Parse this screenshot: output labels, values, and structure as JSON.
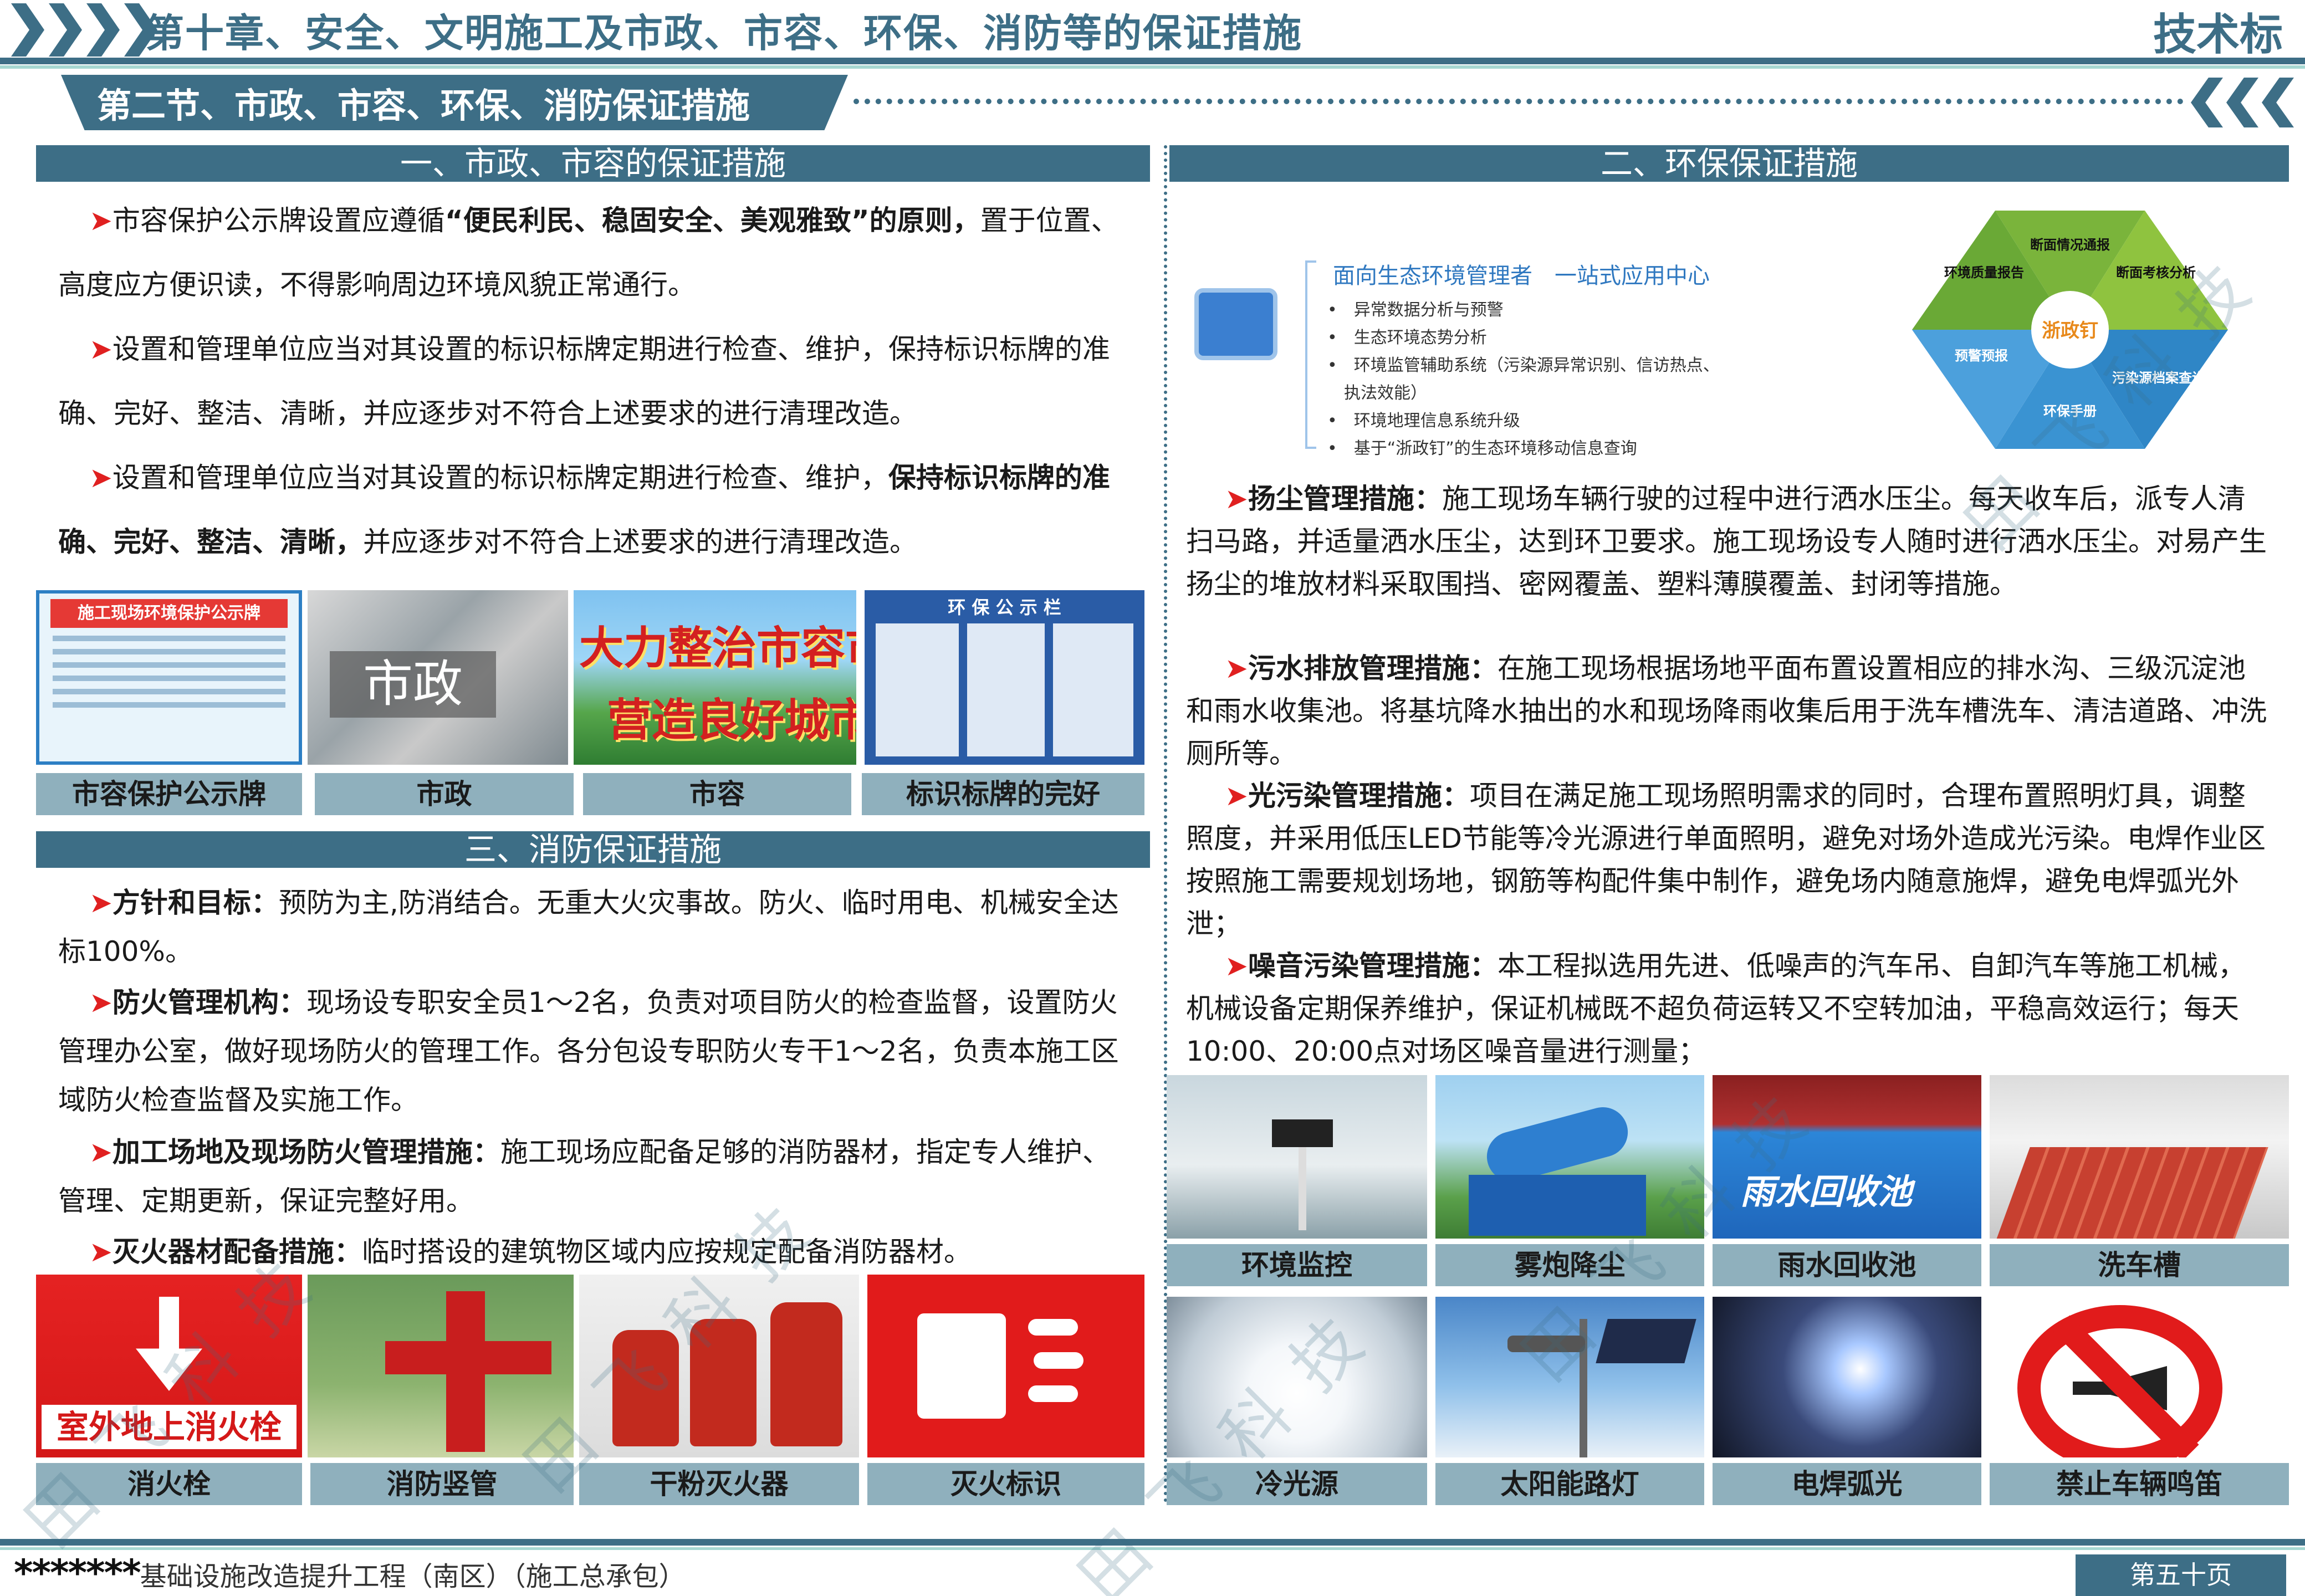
{
  "header": {
    "chapter_title": "第十章、安全、文明施工及市政、市容、环保、消防等的保证措施",
    "chapter_tag": "技术标",
    "section_title": "第二节、市政、市容、环保、消防保证措施"
  },
  "left": {
    "sub1": "一、市政、市容的保证措施",
    "p1_a": "市容保护公示牌设置应遵循",
    "p1_b": "“便民利民、稳固安全、美观雅致”的原则，",
    "p1_c": "置于位置、高度应方便识读，不得影响周边环境风貌正常通行。",
    "p2": "设置和管理单位应当对其设置的标识标牌定期进行检查、维护，保持标识标牌的准确、完好、整洁、清晰，并应逐步对不符合上述要求的进行清理改造。",
    "p3_a": "设置和管理单位应当对其设置的标识标牌定期进行检查、维护，",
    "p3_b": "保持标识标牌的准确、完好、整洁、清晰，",
    "p3_c": "并应逐步对不符合上述要求的进行清理改造。",
    "captions1": [
      "市容保护公示牌",
      "市政",
      "市容",
      "标识标牌的完好"
    ],
    "img1_board_title": "施工现场环境保护公示牌",
    "img1_city_sign": "市政",
    "img1_banner_line1": "大力整治市容市貌",
    "img1_banner_line2": "营造良好城市环境",
    "img1_notice_title": "环 保 公 示 栏",
    "sub3": "三、消防保证措施",
    "f1_label": "方针和目标：",
    "f1_text": "预防为主,防消结合。无重大火灾事故。防火、临时用电、机械安全达标100%。",
    "f2_label": "防火管理机构：",
    "f2_text": "现场设专职安全员1～2名，负责对项目防火的检查监督，设置防火管理办公室，做好现场防火的管理工作。各分包设专职防火专干1～2名，负责本施工区域防火检查监督及实施工作。",
    "f3_label": "加工场地及现场防火管理措施：",
    "f3_text": "施工现场应配备足够的消防器材，指定专人维护、管理、定期更新，保证完整好用。",
    "f4_label": "灭火器材配备措施：",
    "f4_text": "临时搭设的建筑物区域内应按规定配备消防器材。",
    "hydrant_sign": "室外地上消火栓",
    "captions3": [
      "消火栓",
      "消防竖管",
      "干粉灭火器",
      "灭火标识"
    ]
  },
  "right": {
    "sub2": "二、环保保证措施",
    "sys_title": "面向生态环境管理者　一站式应用中心",
    "sys_items": [
      "异常数据分析与预警",
      "生态环境态势分析",
      "环境监管辅助系统（污染源异常识别、信访热点、",
      "执法效能）",
      "环境地理信息系统升级",
      "基于“浙政钉”的生态环境移动信息查询"
    ],
    "hex_center": "浙政钉",
    "hex_labels": [
      "断面情况通报",
      "断面考核分析",
      "污染源档案查询",
      "环保手册",
      "预警预报",
      "环境质量报告"
    ],
    "e1_label": "扬尘管理措施：",
    "e1_text": "施工现场车辆行驶的过程中进行洒水压尘。每天收车后，派专人清扫马路，并适量洒水压尘，达到环卫要求。施工现场设专人随时进行洒水压尘。对易产生扬尘的堆放材料采取围挡、密网覆盖、塑料薄膜覆盖、封闭等措施。",
    "e2_label": "污水排放管理措施：",
    "e2_text": "在施工现场根据场地平面布置设置相应的排水沟、三级沉淀池和雨水收集池。将基坑降水抽出的水和现场降雨收集后用于洗车槽洗车、清洁道路、冲洗厕所等。",
    "e3_label": "光污染管理措施：",
    "e3_text": "项目在满足施工现场照明需求的同时，合理布置照明灯具，调整照度，并采用低压LED节能等冷光源进行单面照明，避免对场外造成光污染。电焊作业区按照施工需要规划场地，钢筋等构配件集中制作，避免场内随意施焊，避免电焊弧光外泄；",
    "e4_label": "噪音污染管理措施：",
    "e4_text": "本工程拟选用先进、低噪声的汽车吊、自卸汽车等施工机械，机械设备定期保养维护，保证机械既不超负荷运转又不空转加油，平稳高效运行；每天10:00、20:00点对场区噪音量进行测量；",
    "pool_text": "雨水回收池",
    "captions_row1": [
      "环境监控",
      "雾炮降尘",
      "雨水回收池",
      "洗车槽"
    ],
    "captions_row2": [
      "冷光源",
      "太阳能路灯",
      "电焊弧光",
      "禁止车辆鸣笛"
    ]
  },
  "footer": {
    "stars": "*******",
    "project": "基础设施改造提升工程（南区）（施工总承包）",
    "page": "第五十页"
  },
  "watermark": "田飞科技"
}
